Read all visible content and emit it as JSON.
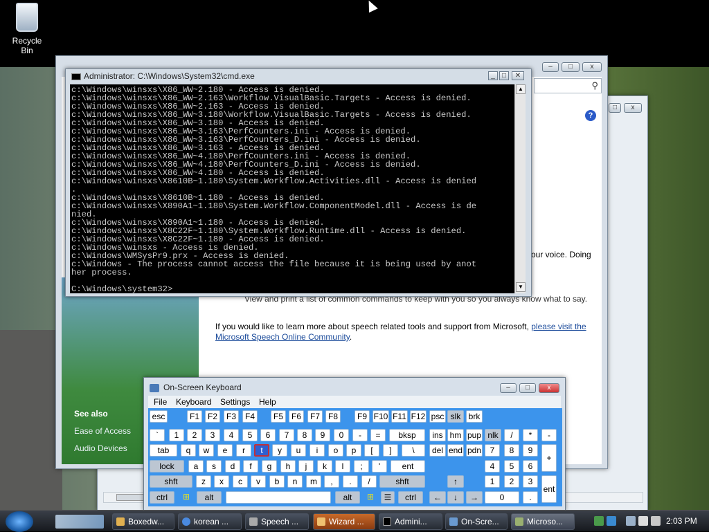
{
  "desktop": {
    "recycle_bin": "Recycle Bin"
  },
  "main_window": {
    "see_also": "See also",
    "see_also_items": [
      "Ease of Access",
      "Audio Devices"
    ],
    "partial_voice": "our voice.  Doing",
    "partial_print": "View and print a list of common commands to keep with you so you always know what to say.",
    "learn_more": "If you would like to learn more about speech related tools and support from Microsoft, ",
    "link_1": "please visit the",
    "link_2": "Microsoft Speech Online Community",
    "period": "."
  },
  "cmd": {
    "title": "Administrator: C:\\Windows\\System32\\cmd.exe",
    "lines": [
      "c:\\Windows\\winsxs\\X86_WW~2.180 - Access is denied.",
      "c:\\Windows\\winsxs\\X86_WW~2.163\\Workflow.VisualBasic.Targets - Access is denied.",
      "c:\\Windows\\winsxs\\X86_WW~2.163 - Access is denied.",
      "c:\\Windows\\winsxs\\X86_WW~3.180\\Workflow.VisualBasic.Targets - Access is denied.",
      "c:\\Windows\\winsxs\\X86_WW~3.180 - Access is denied.",
      "c:\\Windows\\winsxs\\X86_WW~3.163\\PerfCounters.ini - Access is denied.",
      "c:\\Windows\\winsxs\\X86_WW~3.163\\PerfCounters_D.ini - Access is denied.",
      "c:\\Windows\\winsxs\\X86_WW~3.163 - Access is denied.",
      "c:\\Windows\\winsxs\\X86_WW~4.180\\PerfCounters.ini - Access is denied.",
      "c:\\Windows\\winsxs\\X86_WW~4.180\\PerfCounters_D.ini - Access is denied.",
      "c:\\Windows\\winsxs\\X86_WW~4.180 - Access is denied.",
      "c:\\Windows\\winsxs\\X8610B~1.180\\System.Workflow.Activities.dll - Access is denied",
      ".",
      "c:\\Windows\\winsxs\\X8610B~1.180 - Access is denied.",
      "c:\\Windows\\winsxs\\X890A1~1.180\\System.Workflow.ComponentModel.dll - Access is de",
      "nied.",
      "c:\\Windows\\winsxs\\X890A1~1.180 - Access is denied.",
      "c:\\Windows\\winsxs\\X8C22F~1.180\\System.Workflow.Runtime.dll - Access is denied.",
      "c:\\Windows\\winsxs\\X8C22F~1.180 - Access is denied.",
      "c:\\Windows\\winsxs - Access is denied.",
      "c:\\Windows\\WMSysPr9.prx - Access is denied.",
      "c:\\Windows - The process cannot access the file because it is being used by anot",
      "her process.",
      "",
      "C:\\Windows\\system32>"
    ]
  },
  "osk": {
    "title": "On-Screen Keyboard",
    "menu": [
      "File",
      "Keyboard",
      "Settings",
      "Help"
    ],
    "keys": {
      "esc": "esc",
      "f1": "F1",
      "f2": "F2",
      "f3": "F3",
      "f4": "F4",
      "f5": "F5",
      "f6": "F6",
      "f7": "F7",
      "f8": "F8",
      "f9": "F9",
      "f10": "F10",
      "f11": "F11",
      "f12": "F12",
      "psc": "psc",
      "slk": "slk",
      "brk": "brk",
      "tilde": "`",
      "n1": "1",
      "n2": "2",
      "n3": "3",
      "n4": "4",
      "n5": "5",
      "n6": "6",
      "n7": "7",
      "n8": "8",
      "n9": "9",
      "n0": "0",
      "minus": "-",
      "equal": "=",
      "bksp": "bksp",
      "ins": "ins",
      "hm": "hm",
      "pup": "pup",
      "nlk": "nlk",
      "div": "/",
      "mul": "*",
      "sub": "-",
      "tab": "tab",
      "q": "q",
      "w": "w",
      "e": "e",
      "r": "r",
      "t": "t",
      "y": "y",
      "u": "u",
      "i": "i",
      "o": "o",
      "p": "p",
      "lbr": "[",
      "rbr": "]",
      "bsl": "\\",
      "del": "del",
      "end": "end",
      "pdn": "pdn",
      "p7": "7",
      "p8": "8",
      "p9": "9",
      "plus": "+",
      "lock": "lock",
      "a": "a",
      "s": "s",
      "d": "d",
      "f": "f",
      "g": "g",
      "h": "h",
      "j": "j",
      "k": "k",
      "l": "l",
      "semi": ";",
      "quote": "'",
      "ent": "ent",
      "p4": "4",
      "p5": "5",
      "p6": "6",
      "shft": "shft",
      "z": "z",
      "x": "x",
      "c": "c",
      "v": "v",
      "b": "b",
      "n": "n",
      "m": "m",
      "comma": ",",
      "dot": ".",
      "slash": "/",
      "rshft": "shft",
      "p1": "1",
      "p2": "2",
      "p3": "3",
      "pent": "ent",
      "ctrl": "ctrl",
      "alt": "alt",
      "ralt": "alt",
      "rctrl": "ctrl",
      "p0": "0",
      "pdot": "."
    }
  },
  "taskbar": {
    "items": [
      "Boxedw...",
      "korean ...",
      "Speech ...",
      "Wizard ...",
      "Admini...",
      "On-Scre...",
      "Microso..."
    ],
    "clock": "2:03 PM"
  },
  "colors": {
    "osk_keys_bg": "#3c94ec",
    "selected_key": "#2f5fd0"
  }
}
